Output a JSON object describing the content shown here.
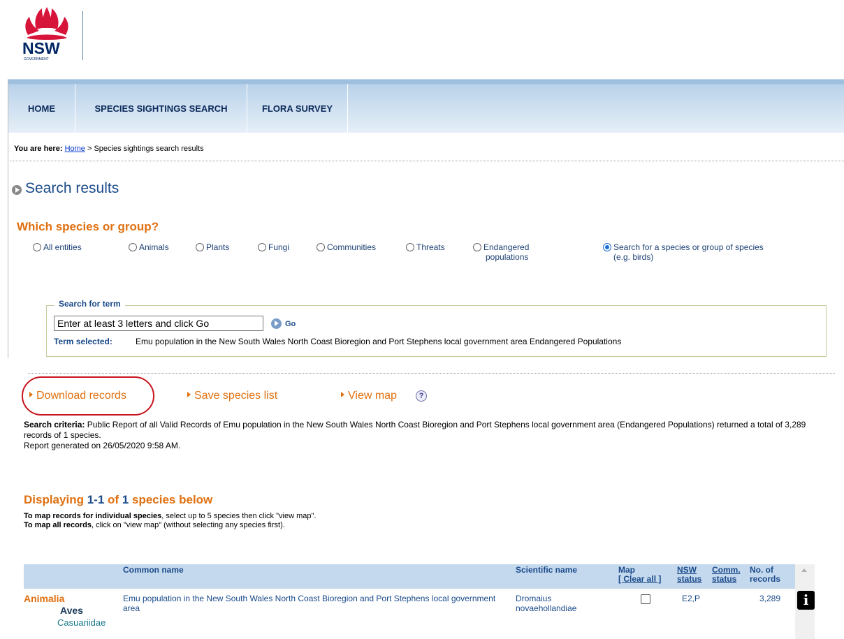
{
  "logo": {
    "wordmark": "NSW",
    "sub": "GOVERNMENT"
  },
  "nav": {
    "home": "HOME",
    "species": "SPECIES SIGHTINGS SEARCH",
    "flora": "FLORA SURVEY"
  },
  "breadcrumb": {
    "prefix": "You are here:",
    "home": "Home",
    "separator": ">",
    "current": "Species sightings search results"
  },
  "title": "Search results",
  "which": {
    "heading": "Which species or group?",
    "options": [
      {
        "label": "All entities",
        "selected": false
      },
      {
        "label": "Animals",
        "selected": false
      },
      {
        "label": "Plants",
        "selected": false
      },
      {
        "label": "Fungi",
        "selected": false
      },
      {
        "label": "Communities",
        "selected": false
      },
      {
        "label": "Threats",
        "selected": false
      },
      {
        "label": "Endangered",
        "label2": "populations",
        "selected": false
      },
      {
        "label": "Search for a species or group of species",
        "label2": "(e.g. birds)",
        "selected": true
      }
    ]
  },
  "search": {
    "legend": "Search for term",
    "placeholder": "Enter at least 3 letters and click Go",
    "go": "Go",
    "term_label": "Term selected:",
    "term_value": "Emu population in the New South Wales North Coast Bioregion and Port Stephens local government area Endangered Populations"
  },
  "actions": {
    "download": "Download records",
    "save": "Save species list",
    "map": "View map",
    "help": "?"
  },
  "criteria": {
    "label": "Search criteria:",
    "text": "Public Report of all Valid Records of Emu population in the New South Wales North Coast Bioregion and Port Stephens local government area (Endangered Populations) returned a total of 3,289 records of 1 species.",
    "generated": "Report generated on 26/05/2020 9:58 AM."
  },
  "display": {
    "word1": "Displaying",
    "range": "1-1",
    "of": "of",
    "count": "1",
    "suffix": "species below",
    "line1_bold": "To map records for individual species",
    "line1_rest": ", select up to 5 species then click \"view map\".",
    "line2_bold": "To map all records",
    "line2_rest": ", click on \"view map\" (without selecting any species first)."
  },
  "table": {
    "headers": {
      "common": "Common name",
      "scientific": "Scientific name",
      "map": "Map",
      "clear_all": "[ Clear all ]",
      "nsw": "NSW",
      "nsw2": "status",
      "comm": "Comm.",
      "comm2": "status",
      "records": "No. of",
      "records2": "records"
    },
    "rows": [
      {
        "kingdom": "Animalia",
        "class": "Aves",
        "family": "Casuariidae",
        "common_name": "Emu population in the New South Wales North Coast Bioregion and Port Stephens local government area",
        "scientific_line1": "Dromaius",
        "scientific_line2": "novaehollandiae",
        "map_checked": false,
        "nsw_status": "E2,P",
        "comm_status": "",
        "records": "3,289",
        "info_icon": "i"
      }
    ]
  },
  "colors": {
    "accent_orange": "#e07010",
    "link_blue": "#1a4a8a",
    "nav_bg": "#b9d2ea",
    "highlight_red": "#c8141e"
  }
}
